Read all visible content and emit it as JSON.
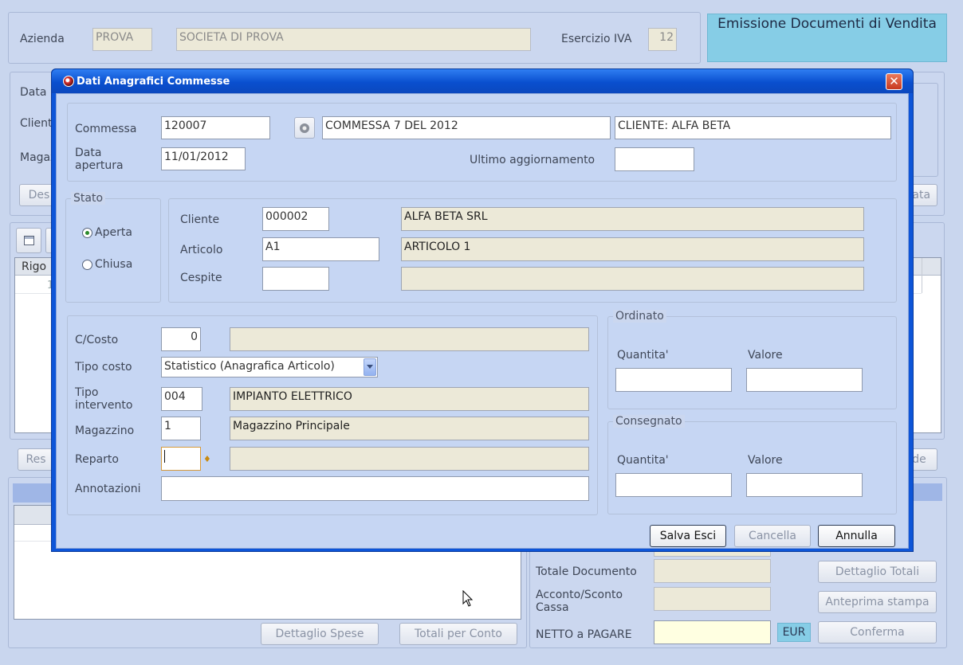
{
  "header": {
    "azienda_label": "Azienda",
    "azienda_code": "PROVA",
    "azienda_name": "SOCIETA DI PROVA",
    "esercizio_label": "Esercizio IVA",
    "esercizio_value": "12",
    "banner_title": "Emissione Documenti di Vendita"
  },
  "background": {
    "data_label": "Data",
    "cliente_label": "Cliente",
    "magazzino_label": "Magaz",
    "btn_des": "Des",
    "btn_tata": "tata",
    "grid_header_rigo": "Rigo",
    "grid_row1": "1",
    "btn_res": "Res",
    "btn_de": "de",
    "btn_dettaglio_spese": "Dettaglio Spese",
    "btn_totali_per_conto": "Totali per Conto",
    "totale_documento_label": "Totale Documento",
    "acconto_label": "Acconto/Sconto Cassa",
    "netto_label": "NETTO a PAGARE",
    "currency": "EUR",
    "btn_dettaglio_totali": "Dettaglio Totali",
    "btn_anteprima_stampa": "Anteprima stampa",
    "btn_conferma": "Conferma"
  },
  "dialog": {
    "title": "Dati Anagrafici Commesse",
    "commessa_label": "Commessa",
    "commessa_value": "120007",
    "commessa_desc": "COMMESSA 7 DEL 2012",
    "commessa_cliente": "CLIENTE: ALFA BETA",
    "data_apertura_label": "Data apertura",
    "data_apertura_value": "11/01/2012",
    "ultimo_agg_label": "Ultimo aggiornamento",
    "ultimo_agg_value": "",
    "stato": {
      "title": "Stato",
      "aperta": "Aperta",
      "chiusa": "Chiusa",
      "selected": "Aperta"
    },
    "cliente_label": "Cliente",
    "cliente_code": "000002",
    "cliente_name": "ALFA BETA SRL",
    "articolo_label": "Articolo",
    "articolo_code": "A1",
    "articolo_name": "ARTICOLO 1",
    "cespite_label": "Cespite",
    "cespite_code": "",
    "cespite_name": "",
    "ccosto_label": "C/Costo",
    "ccosto_value": "0",
    "ccosto_desc": "",
    "tipo_costo_label": "Tipo costo",
    "tipo_costo_value": "Statistico (Anagrafica Articolo)",
    "tipo_intervento_label": "Tipo intervento",
    "tipo_intervento_code": "004",
    "tipo_intervento_desc": "IMPIANTO ELETTRICO",
    "magazzino_label": "Magazzino",
    "magazzino_code": "1",
    "magazzino_desc": "Magazzino Principale",
    "reparto_label": "Reparto",
    "reparto_code": "",
    "reparto_desc": "",
    "annotazioni_label": "Annotazioni",
    "annotazioni_value": "",
    "ordinato": {
      "title": "Ordinato",
      "quantita_label": "Quantita'",
      "valore_label": "Valore",
      "quantita": "",
      "valore": ""
    },
    "consegnato": {
      "title": "Consegnato",
      "quantita_label": "Quantita'",
      "valore_label": "Valore",
      "quantita": "",
      "valore": ""
    },
    "btn_salva_esci": "Salva Esci",
    "btn_cancella": "Cancella",
    "btn_annulla": "Annulla"
  },
  "colors": {
    "banner": "#86cde6",
    "title_bar": "#0a4fcf",
    "dialog_body": "#c6d6f3",
    "readonly_field": "#ece9d8",
    "close_button": "#d8452c"
  },
  "icons": {
    "app_icon": "app-icon",
    "close": "close-icon",
    "lookup": "gear-icon",
    "key": "key-icon",
    "dropdown": "chevron-down-icon",
    "cursor": "mouse-cursor"
  }
}
